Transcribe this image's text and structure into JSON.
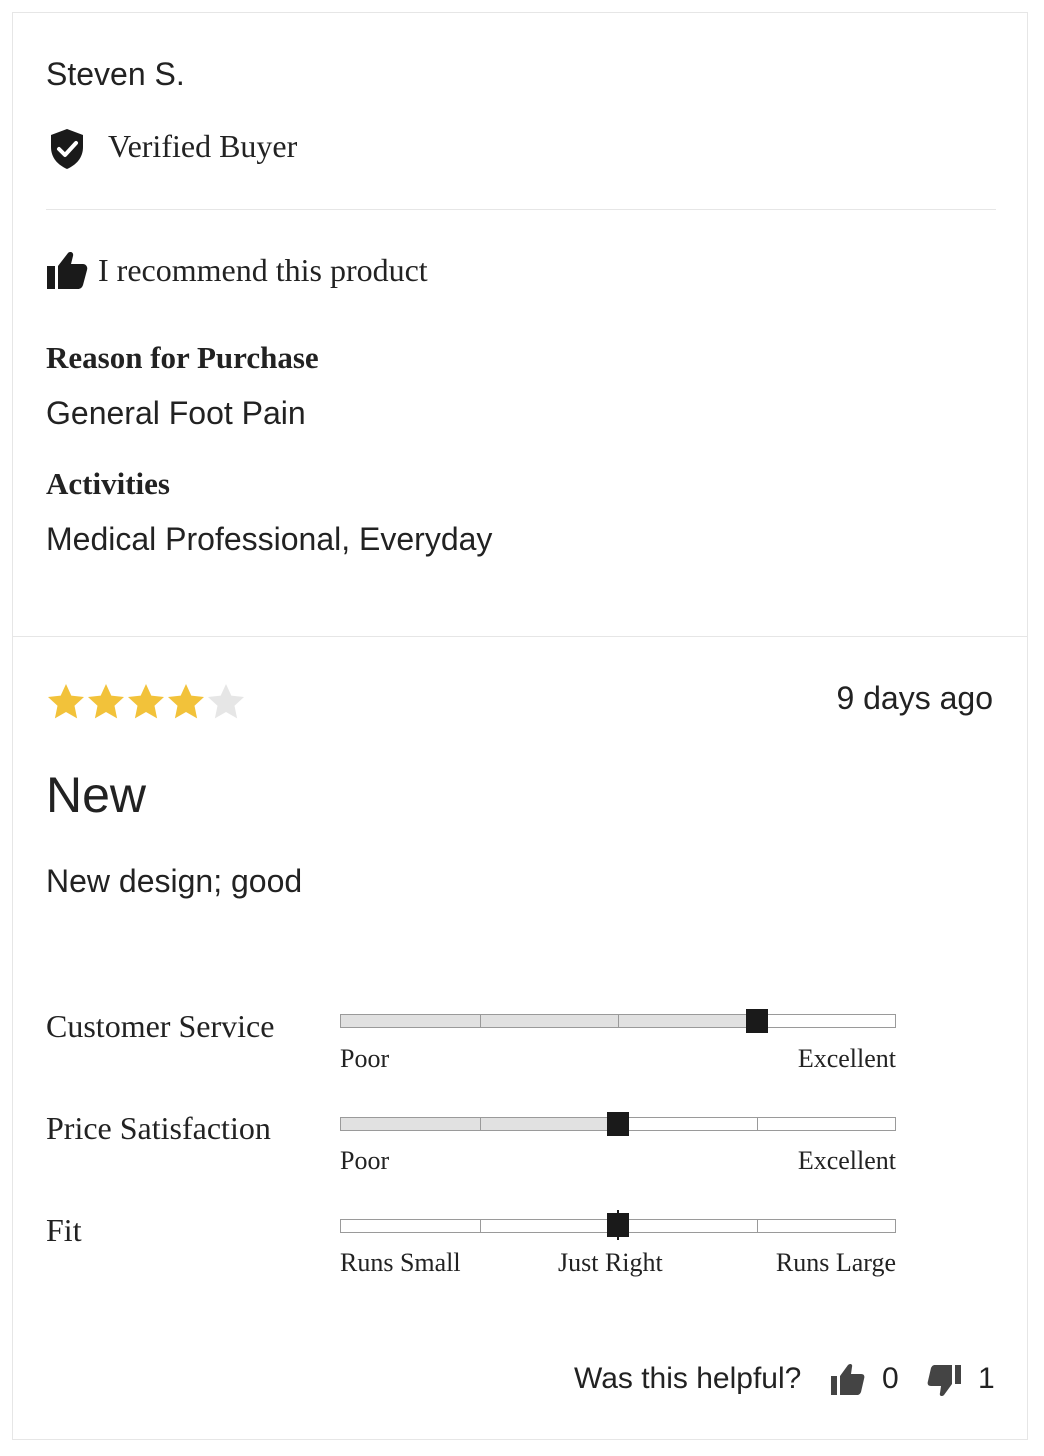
{
  "reviewer": {
    "name": "Steven S.",
    "badge": "Verified Buyer",
    "badge_icon": "shield-check-icon"
  },
  "recommendation": {
    "text": "I recommend this product",
    "icon": "thumbs-up-icon"
  },
  "reason": {
    "heading": "Reason for Purchase",
    "value": "General Foot Pain"
  },
  "activities": {
    "heading": "Activities",
    "value": "Medical Professional, Everyday"
  },
  "review": {
    "rating": 4,
    "rating_max": 5,
    "star_color": "#f2c23a",
    "star_empty_color": "#e6e6e6",
    "timestamp": "9 days ago",
    "title": "New",
    "body": "New design; good"
  },
  "ratings": {
    "customer_service": {
      "label": "Customer Service",
      "value_fraction": 0.75,
      "low": "Poor",
      "high": "Excellent"
    },
    "price_satisfaction": {
      "label": "Price Satisfaction",
      "value_fraction": 0.5,
      "low": "Poor",
      "high": "Excellent"
    },
    "fit": {
      "label": "Fit",
      "value_fraction": 0.5,
      "low": "Runs Small",
      "mid": "Just Right",
      "high": "Runs Large"
    }
  },
  "helpful": {
    "question": "Was this helpful?",
    "up_count": "0",
    "down_count": "1"
  }
}
